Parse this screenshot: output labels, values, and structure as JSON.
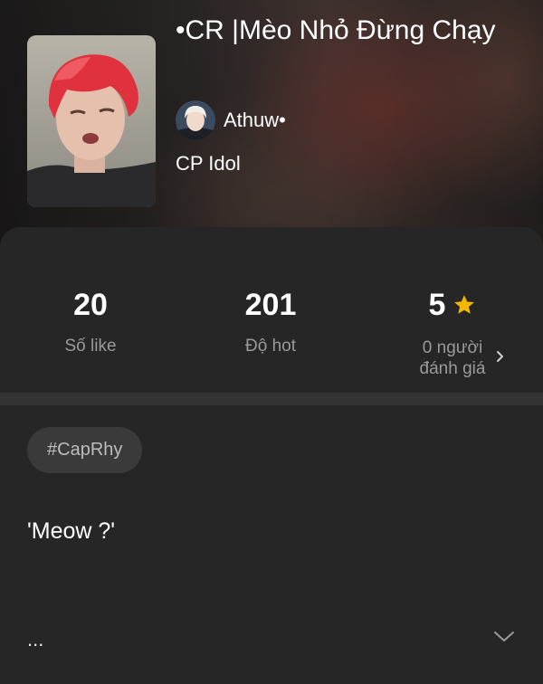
{
  "story": {
    "title": "•CR |Mèo Nhỏ Đừng Chạy",
    "author": "Athuw•",
    "category": "CP Idol",
    "cover_icon": "book-cover-image",
    "avatar_icon": "author-avatar-image"
  },
  "stats": {
    "likes_value": "20",
    "likes_label": "Số like",
    "hot_value": "201",
    "hot_label": "Độ hot",
    "rating_value": "5",
    "rating_label_line1": "0 người",
    "rating_label_line2": "đánh giá",
    "star_color": "#f5b800"
  },
  "tags": [
    "#CapRhy"
  ],
  "description": {
    "quote": "'Meow ?'",
    "ellipsis": "..."
  },
  "colors": {
    "background": "#262626",
    "divider": "#333333",
    "tag_bg": "#3a3a3a",
    "muted_text": "#9a9a9a"
  }
}
